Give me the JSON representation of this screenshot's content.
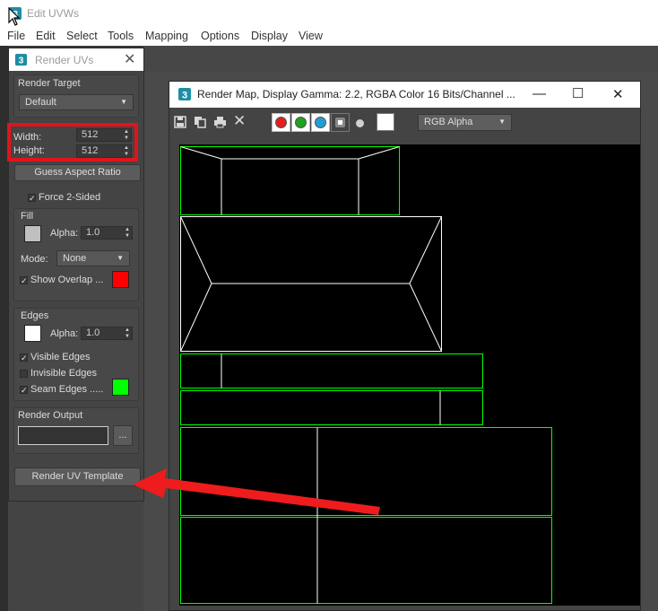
{
  "edit_uvws": {
    "title": "Edit UVWs",
    "menus": [
      "File",
      "Edit",
      "Select",
      "Tools",
      "Mapping",
      "Options",
      "Display",
      "View"
    ]
  },
  "render_uvs": {
    "title": "Render UVs",
    "render_target_label": "Render Target",
    "render_target_value": "Default",
    "width_label": "Width:",
    "width_value": "512",
    "height_label": "Height:",
    "height_value": "512",
    "guess_aspect_label": "Guess Aspect Ratio",
    "force_two_sided_label": "Force 2-Sided",
    "force_two_sided_checked": true,
    "fill": {
      "group_label": "Fill",
      "color": "#c0c0c0",
      "alpha_label": "Alpha:",
      "alpha_value": "1.0",
      "mode_label": "Mode:",
      "mode_value": "None",
      "show_overlap_label": "Show Overlap ...",
      "show_overlap_checked": true,
      "overlap_color": "#ff0000"
    },
    "edges": {
      "group_label": "Edges",
      "color": "#ffffff",
      "alpha_label": "Alpha:",
      "alpha_value": "1.0",
      "visible_edges_label": "Visible Edges",
      "visible_edges_checked": true,
      "invisible_edges_label": "Invisible Edges",
      "invisible_edges_checked": false,
      "seam_edges_label": "Seam Edges .....",
      "seam_edges_checked": true,
      "seam_color": "#00ff00"
    },
    "render_output_label": "Render Output",
    "render_output_value": "",
    "browse_label": "...",
    "render_template_label": "Render UV Template"
  },
  "render_map": {
    "title": "Render Map, Display Gamma: 2.2, RGBA Color 16 Bits/Channel ...",
    "channel_select_value": "RGB Alpha",
    "channel_colors": {
      "red": "#e02020",
      "green": "#20a020",
      "blue": "#20a0d0"
    }
  },
  "annotations": {
    "highlight_color": "#e0141a",
    "arrow_color": "#ee1c1c"
  }
}
